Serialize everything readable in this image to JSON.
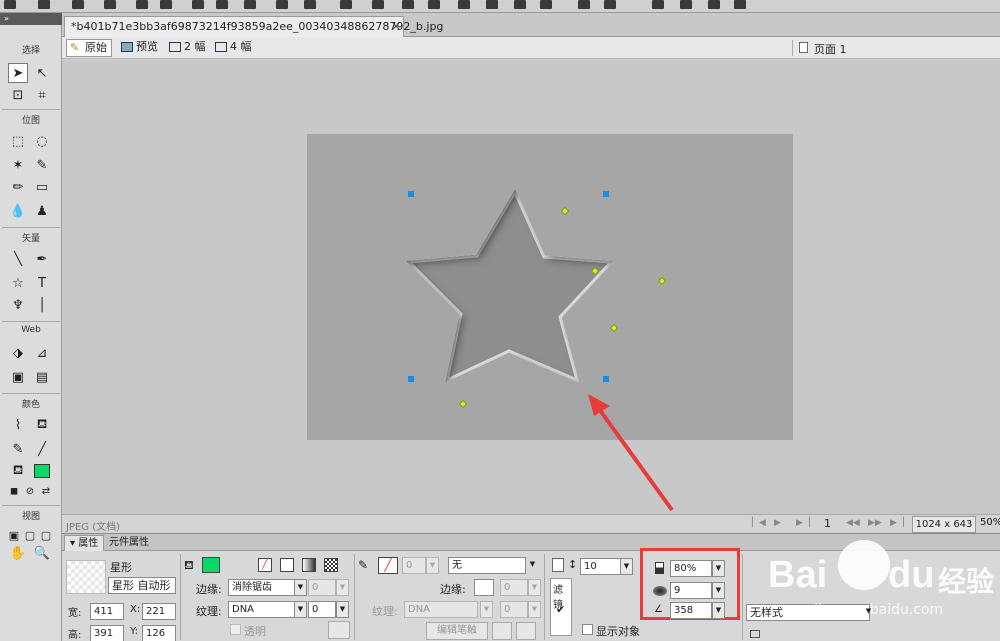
{
  "document": {
    "tab_title": "*b401b71e3bb3af69873214f93859a2ee_0034034886278792_b.jpg",
    "close_glyph": "×"
  },
  "tools_panel": {
    "sections": {
      "select": "选择",
      "bitmap": "位图",
      "vector": "矢量",
      "web": "Web",
      "colors": "颜色",
      "view": "视图"
    }
  },
  "view_bar": {
    "original": "原始",
    "preview": "预览",
    "two_up": "2 幅",
    "four_up": "4 幅",
    "page": "页面 1"
  },
  "status": {
    "text": "JPEG (文档)",
    "frame": "1",
    "image_size": "1024 x 643",
    "zoom": "50%"
  },
  "properties": {
    "tab_props": "属性",
    "tab_symbol": "元件属性",
    "object_type": "星形",
    "object_name": "星形 自动形",
    "width_label": "宽:",
    "width": "411",
    "height_label": "高:",
    "height": "391",
    "x_label": "X:",
    "x": "221",
    "y_label": "Y:",
    "y": "126",
    "edge_label": "边缘:",
    "edge_value": "消除锯齿",
    "edge_amount": "0",
    "texture_label": "纹理:",
    "texture_value": "DNA",
    "texture_amount": "0",
    "transparent_label": "透明",
    "stroke_size": "0",
    "stroke_type": "无",
    "stroke_edge_label": "边缘:",
    "stroke_edge_amount": "0",
    "stroke_texture_label": "纹理:",
    "stroke_texture_value": "DNA",
    "stroke_texture_amount": "0",
    "edit_stroke_button": "编辑笔触",
    "opacity_value": "10",
    "filter_label": "滤镜",
    "show_object_label": "显示对象",
    "shadow_opacity": "80%",
    "shadow_softness": "9",
    "shadow_angle": "358",
    "style_value": "无样式"
  },
  "watermark": {
    "brand": "Bai",
    "brand2": "du",
    "cn": "经验",
    "url": "jingyan.baidu.com"
  },
  "colors": {
    "fill": "#0cd868",
    "highlight": "#e83b3b",
    "handle": "#1e8ce0",
    "diamond": "#c8f034"
  }
}
